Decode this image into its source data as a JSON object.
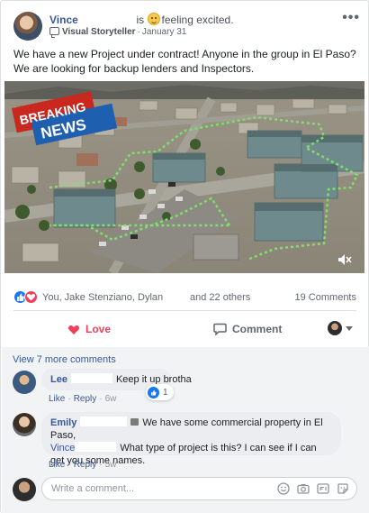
{
  "post": {
    "author": "Vince",
    "feeling_text": "is",
    "feeling_label": "feeling excited.",
    "badge": "Visual Storyteller",
    "date": "January 31",
    "more_icon": "more-dots-icon",
    "text": "We have a new Project under contract! Anyone in the group in El Paso? We are looking for backup lenders and Inspectors.",
    "media": {
      "overlay_text_1": "BREAKING",
      "overlay_text_2": "NEWS",
      "volume_icon": "volume-muted-icon"
    }
  },
  "reactions": {
    "icons": [
      "like-icon",
      "love-icon"
    ],
    "names": "You, Jake Stenziano, Dylan",
    "others": "and 22 others",
    "comment_count": "19 Comments"
  },
  "actions": {
    "love_label": "Love",
    "comment_label": "Comment"
  },
  "comments": {
    "view_more": "View 7 more comments",
    "items": [
      {
        "name": "Lee",
        "text": "Keep it up brotha",
        "like_count": "1",
        "like_label": "Like",
        "reply_label": "Reply",
        "time": "6w"
      },
      {
        "name": "Emily",
        "text_line1": "We have some commercial property in El Paso,",
        "mention": "Vince",
        "text_line2": "What type of project is this? I can see if I can get you some names.",
        "like_label": "Like",
        "reply_label": "Reply",
        "time": "5w"
      }
    ],
    "write_placeholder": "Write a comment..."
  },
  "colors": {
    "link_blue": "#385898",
    "like_blue": "#1877f2",
    "love_red": "#f33e58",
    "trail_green": "#7de06a"
  }
}
